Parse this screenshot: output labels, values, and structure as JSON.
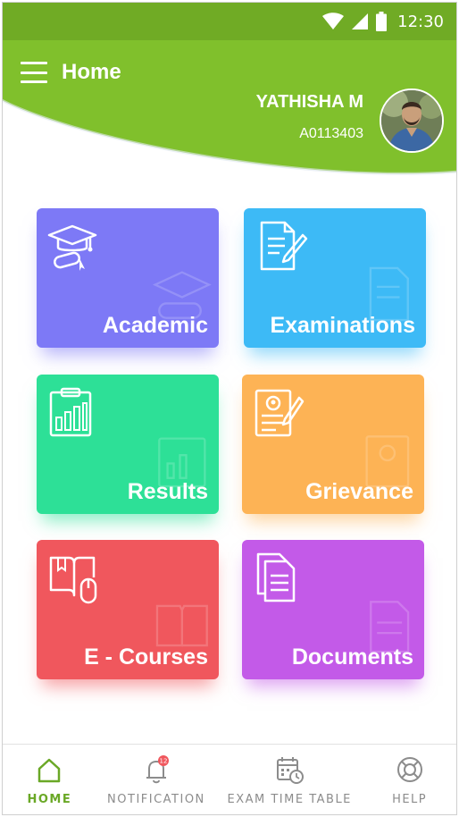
{
  "status_bar": {
    "time": "12:30"
  },
  "header": {
    "title": "Home",
    "user_name": "YATHISHA M",
    "user_id": "A0113403",
    "brand_color": "#80c02c"
  },
  "tiles": [
    {
      "label": "Academic",
      "icon": "graduation-cap-icon",
      "color": "#7d79f6"
    },
    {
      "label": "Examinations",
      "icon": "exam-paper-pen-icon",
      "color": "#3dbaf6"
    },
    {
      "label": "Results",
      "icon": "results-chart-icon",
      "color": "#2de097"
    },
    {
      "label": "Grievance",
      "icon": "grievance-form-icon",
      "color": "#fdb355"
    },
    {
      "label": "E - Courses",
      "icon": "book-mouse-icon",
      "color": "#f0575d"
    },
    {
      "label": "Documents",
      "icon": "documents-icon",
      "color": "#c35ae8"
    }
  ],
  "bottom_nav": [
    {
      "label": "HOME",
      "icon": "home-icon",
      "active": true
    },
    {
      "label": "NOTIFICATION",
      "icon": "bell-icon",
      "badge": "12"
    },
    {
      "label": "EXAM TIME TABLE",
      "icon": "calendar-clock-icon"
    },
    {
      "label": "HELP",
      "icon": "lifebuoy-icon"
    }
  ]
}
